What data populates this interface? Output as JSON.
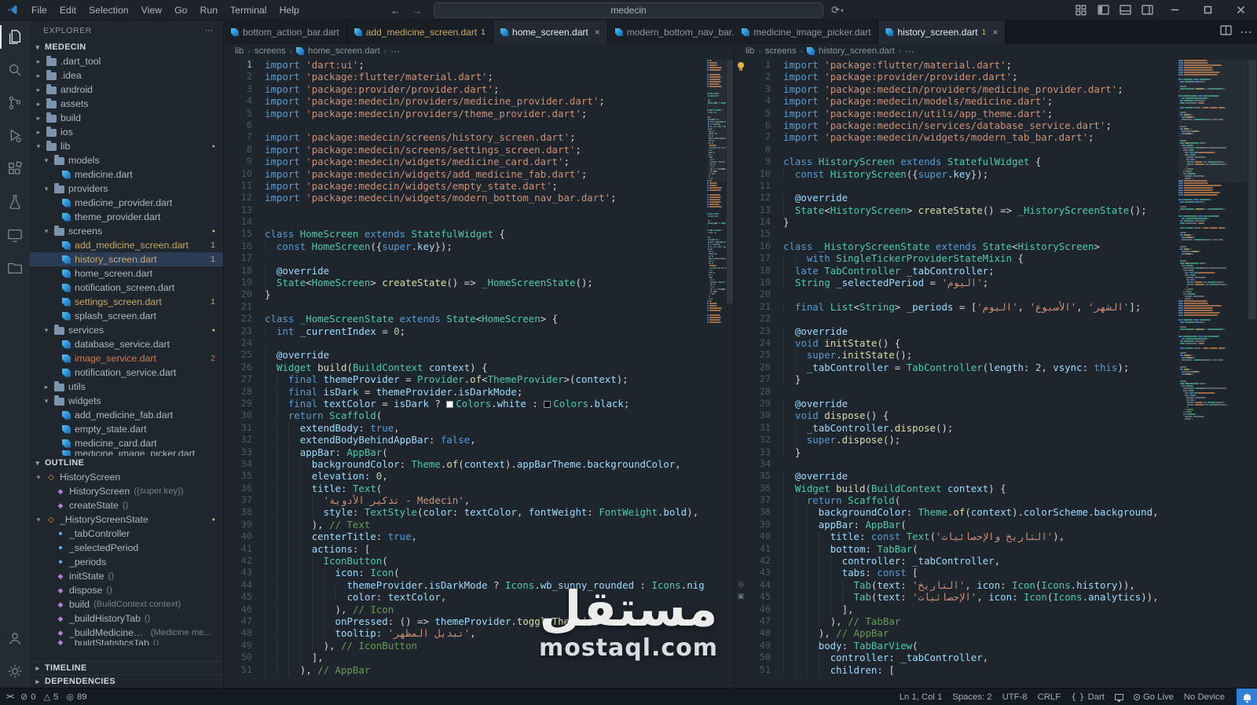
{
  "titlebar": {
    "menus": [
      "File",
      "Edit",
      "Selection",
      "View",
      "Go",
      "Run",
      "Terminal",
      "Help"
    ],
    "search_value": "medecin"
  },
  "icons": {
    "ellipsis": "⋯",
    "chev_down": "▾",
    "chev_right": "▸",
    "close": "×",
    "back": "←",
    "forward": "→",
    "sync": "⟳",
    "crumb_sep": "›",
    "remote": "><"
  },
  "tabs": {
    "left_group": [
      {
        "label": "bottom_action_bar.dart",
        "active": false
      },
      {
        "label": "add_medicine_screen.dart",
        "badge": "1",
        "color": "warn",
        "active": false
      },
      {
        "label": "home_screen.dart",
        "active": true,
        "close": true
      },
      {
        "label": "modern_bottom_nav_bar.dart",
        "active": false
      }
    ],
    "right_group": [
      {
        "label": "medicine_image_picker.dart",
        "active": false
      },
      {
        "label": "history_screen.dart",
        "badge": "1",
        "active": true,
        "close": true
      }
    ]
  },
  "breadcrumbs": {
    "left": {
      "path": [
        "lib",
        "screens"
      ],
      "file": "home_screen.dart"
    },
    "right": {
      "path": [
        "lib",
        "screens"
      ],
      "file": "history_screen.dart"
    }
  },
  "explorer": {
    "title": "EXPLORER",
    "root": "MEDECIN",
    "items": [
      {
        "l": ".dart_tool",
        "d": 0,
        "k": "folder"
      },
      {
        "l": ".idea",
        "d": 0,
        "k": "folder"
      },
      {
        "l": "android",
        "d": 0,
        "k": "folder"
      },
      {
        "l": "assets",
        "d": 0,
        "k": "folder"
      },
      {
        "l": "build",
        "d": 0,
        "k": "folder"
      },
      {
        "l": "ios",
        "d": 0,
        "k": "folder"
      },
      {
        "l": "lib",
        "d": 0,
        "k": "folder",
        "open": true,
        "dot": "#9aa4b1"
      },
      {
        "l": "models",
        "d": 1,
        "k": "folder",
        "open": true
      },
      {
        "l": "medicine.dart",
        "d": 2,
        "k": "dart"
      },
      {
        "l": "providers",
        "d": 1,
        "k": "folder",
        "open": true
      },
      {
        "l": "medicine_provider.dart",
        "d": 2,
        "k": "dart"
      },
      {
        "l": "theme_provider.dart",
        "d": 2,
        "k": "dart"
      },
      {
        "l": "screens",
        "d": 1,
        "k": "folder",
        "open": true,
        "dot": "#d7ba7d"
      },
      {
        "l": "add_medicine_screen.dart",
        "d": 2,
        "k": "dart",
        "badge": "1",
        "color": "warn"
      },
      {
        "l": "history_screen.dart",
        "d": 2,
        "k": "dart",
        "badge": "1",
        "color": "warn",
        "selected": true
      },
      {
        "l": "home_screen.dart",
        "d": 2,
        "k": "dart"
      },
      {
        "l": "notification_screen.dart",
        "d": 2,
        "k": "dart"
      },
      {
        "l": "settings_screen.dart",
        "d": 2,
        "k": "dart",
        "badge": "1",
        "color": "warn"
      },
      {
        "l": "splash_screen.dart",
        "d": 2,
        "k": "dart"
      },
      {
        "l": "services",
        "d": 1,
        "k": "folder",
        "open": true,
        "dot": "#d7ba7d"
      },
      {
        "l": "database_service.dart",
        "d": 2,
        "k": "dart"
      },
      {
        "l": "image_service.dart",
        "d": 2,
        "k": "dart",
        "badge": "2",
        "color": "error"
      },
      {
        "l": "notification_service.dart",
        "d": 2,
        "k": "dart"
      },
      {
        "l": "utils",
        "d": 1,
        "k": "folder"
      },
      {
        "l": "widgets",
        "d": 1,
        "k": "folder",
        "open": true
      },
      {
        "l": "add_medicine_fab.dart",
        "d": 2,
        "k": "dart"
      },
      {
        "l": "empty_state.dart",
        "d": 2,
        "k": "dart"
      },
      {
        "l": "medicine_card.dart",
        "d": 2,
        "k": "dart"
      },
      {
        "l": "medicine_image_picker.dart",
        "d": 2,
        "k": "dart",
        "clipped": true
      }
    ]
  },
  "outline": {
    "title": "OUTLINE",
    "items": [
      {
        "l": "HistoryScreen",
        "k": "class",
        "d": 0,
        "chev": true
      },
      {
        "l": "HistoryScreen",
        "detail": "({super.key})",
        "k": "ctor",
        "d": 1
      },
      {
        "l": "createState",
        "detail": "()",
        "k": "method",
        "d": 1
      },
      {
        "l": "_HistoryScreenState",
        "k": "class",
        "d": 0,
        "chev": true,
        "dot": "#d7ba7d"
      },
      {
        "l": "_tabController",
        "k": "field",
        "d": 1
      },
      {
        "l": "_selectedPeriod",
        "k": "field",
        "d": 1
      },
      {
        "l": "_periods",
        "k": "field",
        "d": 1
      },
      {
        "l": "initState",
        "detail": "()",
        "k": "method",
        "d": 1
      },
      {
        "l": "dispose",
        "detail": "()",
        "k": "method",
        "d": 1
      },
      {
        "l": "build",
        "detail": "(BuildContext context)",
        "k": "method",
        "d": 1
      },
      {
        "l": "_buildHistoryTab",
        "detail": "()",
        "k": "method",
        "d": 1
      },
      {
        "l": "_buildMedicineHistoryCard",
        "detail": "(Medicine me...",
        "k": "method",
        "d": 1
      },
      {
        "l": "_buildStatisticsTab",
        "detail": "()",
        "k": "method",
        "d": 1,
        "clipped": true
      }
    ]
  },
  "sections": {
    "timeline": "TIMELINE",
    "dependencies": "DEPENDENCIES"
  },
  "editors": {
    "left": {
      "active_line": 1,
      "diagnostics": [
        {
          "line": 1,
          "text": "'dart:ui'"
        }
      ],
      "lines": [
        "import 'dart:ui';",
        "import 'package:flutter/material.dart';",
        "import 'package:provider/provider.dart';",
        "import 'package:medecin/providers/medicine_provider.dart';",
        "import 'package:medecin/providers/theme_provider.dart';",
        "",
        "import 'package:medecin/screens/history_screen.dart';",
        "import 'package:medecin/screens/settings_screen.dart';",
        "import 'package:medecin/widgets/medicine_card.dart';",
        "import 'package:medecin/widgets/add_medicine_fab.dart';",
        "import 'package:medecin/widgets/empty_state.dart';",
        "import 'package:medecin/widgets/modern_bottom_nav_bar.dart';",
        "",
        "",
        "class HomeScreen extends StatefulWidget {",
        "  const HomeScreen({super.key});",
        "",
        "  @override",
        "  State<HomeScreen> createState() => _HomeScreenState();",
        "}",
        "",
        "class _HomeScreenState extends State<HomeScreen> {",
        "  int _currentIndex = 0;",
        "",
        "  @override",
        "  Widget build(BuildContext context) {",
        "    final themeProvider = Provider.of<ThemeProvider>(context);",
        "    final isDark = themeProvider.isDarkMode;",
        "    final textColor = isDark ? Colors.white : Colors.black;",
        "    return Scaffold(",
        "      extendBody: true,",
        "      extendBodyBehindAppBar: false,",
        "      appBar: AppBar(",
        "        backgroundColor: Theme.of(context).appBarTheme.backgroundColor,",
        "        elevation: 0,",
        "        title: Text(",
        "          'تذكير الأدوية - Medecin',",
        "          style: TextStyle(color: textColor, fontWeight: FontWeight.bold),",
        "        ), // Text",
        "        centerTitle: true,",
        "        actions: [",
        "          IconButton(",
        "            icon: Icon(",
        "              themeProvider.isDarkMode ? Icons.wb_sunny_rounded : Icons.nightlight_round,",
        "              color: textColor,",
        "            ), // Icon",
        "            onPressed: () => themeProvider.toggleTheme(),",
        "            tooltip: 'تبديل المظهر',",
        "          ), // IconButton",
        "        ],",
        "      ), // AppBar"
      ]
    },
    "right": {
      "lightbulb_line": 1,
      "diagnostics": [
        {
          "line": 38,
          "text": "background"
        }
      ],
      "gutter_icons": [
        {
          "line": 44,
          "kind": "circle"
        },
        {
          "line": 45,
          "kind": "square"
        }
      ],
      "lines": [
        "import 'package:flutter/material.dart';",
        "import 'package:provider/provider.dart';",
        "import 'package:medecin/providers/medicine_provider.dart';",
        "import 'package:medecin/models/medicine.dart';",
        "import 'package:medecin/utils/app_theme.dart';",
        "import 'package:medecin/services/database_service.dart';",
        "import 'package:medecin/widgets/modern_tab_bar.dart';",
        "",
        "class HistoryScreen extends StatefulWidget {",
        "  const HistoryScreen({super.key});",
        "",
        "  @override",
        "  State<HistoryScreen> createState() => _HistoryScreenState();",
        "}",
        "",
        "class _HistoryScreenState extends State<HistoryScreen>",
        "    with SingleTickerProviderStateMixin {",
        "  late TabController _tabController;",
        "  String _selectedPeriod = 'اليوم';",
        "",
        "  final List<String> _periods = ['اليوم', 'الأسبوع', 'الشهر'];",
        "",
        "  @override",
        "  void initState() {",
        "    super.initState();",
        "    _tabController = TabController(length: 2, vsync: this);",
        "  }",
        "",
        "  @override",
        "  void dispose() {",
        "    _tabController.dispose();",
        "    super.dispose();",
        "  }",
        "",
        "  @override",
        "  Widget build(BuildContext context) {",
        "    return Scaffold(",
        "      backgroundColor: Theme.of(context).colorScheme.background,",
        "      appBar: AppBar(",
        "        title: const Text('التاريخ والإحصائيات'),",
        "        bottom: TabBar(",
        "          controller: _tabController,",
        "          tabs: const [",
        "            Tab(text: 'التاريخ', icon: Icon(Icons.history)),",
        "            Tab(text: 'الإحصائيات', icon: Icon(Icons.analytics)),",
        "          ],",
        "        ), // TabBar",
        "      ), // AppBar",
        "      body: TabBarView(",
        "        controller: _tabController,",
        "        children: ["
      ]
    }
  },
  "statusbar": {
    "left": [
      {
        "icon": "remote"
      },
      {
        "icon": "error",
        "label": "0"
      },
      {
        "icon": "warning",
        "label": "5"
      },
      {
        "icon": "circle",
        "label": "89"
      }
    ],
    "right": [
      {
        "label": "Ln 1, Col 1"
      },
      {
        "label": "Spaces: 2"
      },
      {
        "label": "UTF-8"
      },
      {
        "label": "CRLF"
      },
      {
        "icon": "braces",
        "label": "Dart"
      },
      {
        "icon": "screen"
      },
      {
        "icon": "broadcast",
        "label": "Go Live"
      },
      {
        "label": "No Device"
      },
      {
        "icon": "bell",
        "highlight": true
      }
    ]
  },
  "watermark": {
    "line1": "مستقل",
    "line2": "mostaql.com"
  }
}
